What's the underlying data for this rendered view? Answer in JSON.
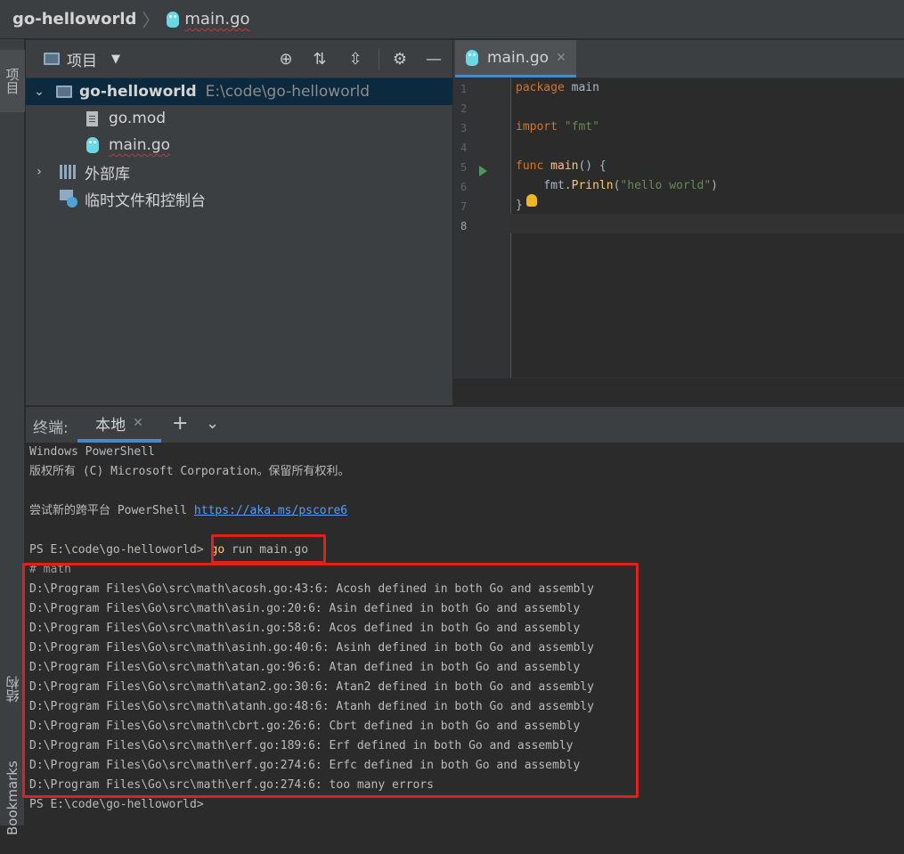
{
  "title_bar": {
    "project": "go-helloworld",
    "separator": "〉",
    "file": "main.go"
  },
  "left_strip": {
    "project_tab": "项目",
    "structure_tab": "结构",
    "bookmarks_tab": "Bookmarks"
  },
  "project_panel": {
    "title": "项目",
    "tree": [
      {
        "label": "go-helloworld",
        "path": "E:\\code\\go-helloworld"
      },
      {
        "label": "go.mod"
      },
      {
        "label": "main.go"
      },
      {
        "label": "外部库"
      },
      {
        "label": "临时文件和控制台"
      }
    ]
  },
  "editor": {
    "tab_label": "main.go",
    "line_numbers": [
      "1",
      "2",
      "3",
      "4",
      "5",
      "6",
      "7",
      "8"
    ],
    "lines": {
      "l1_kw": "package",
      "l1_rest": " main",
      "l3_kw": "import",
      "l3_str": "\"fmt\"",
      "l5_kw": "func",
      "l5_fn": "main",
      "l5_rest": "() {",
      "l6_pkg": "    fmt.",
      "l6_mth": "Prinln",
      "l6_open": "(",
      "l6_str": "\"hello world\"",
      "l6_close": ")",
      "l7": "}"
    }
  },
  "terminal": {
    "label": "终端:",
    "tab": "本地",
    "lines": [
      "Windows PowerShell",
      "版权所有 (C) Microsoft Corporation。保留所有权利。",
      "",
      "",
      "",
      "PS E:\\code\\go-helloworld> ",
      "# math",
      "D:\\Program Files\\Go\\src\\math\\acosh.go:43:6: Acosh defined in both Go and assembly",
      "D:\\Program Files\\Go\\src\\math\\asin.go:20:6: Asin defined in both Go and assembly",
      "D:\\Program Files\\Go\\src\\math\\asin.go:58:6: Acos defined in both Go and assembly",
      "D:\\Program Files\\Go\\src\\math\\asinh.go:40:6: Asinh defined in both Go and assembly",
      "D:\\Program Files\\Go\\src\\math\\atan.go:96:6: Atan defined in both Go and assembly",
      "D:\\Program Files\\Go\\src\\math\\atan2.go:30:6: Atan2 defined in both Go and assembly",
      "D:\\Program Files\\Go\\src\\math\\atanh.go:48:6: Atanh defined in both Go and assembly",
      "D:\\Program Files\\Go\\src\\math\\cbrt.go:26:6: Cbrt defined in both Go and assembly",
      "D:\\Program Files\\Go\\src\\math\\erf.go:189:6: Erf defined in both Go and assembly",
      "D:\\Program Files\\Go\\src\\math\\erf.go:274:6: Erfc defined in both Go and assembly",
      "D:\\Program Files\\Go\\src\\math\\erf.go:274:6: too many errors",
      "PS E:\\code\\go-helloworld>"
    ],
    "pscore_prefix": "尝试新的跨平台 PowerShell ",
    "pscore_link": "https://aka.ms/pscore6",
    "cmd_go": "go",
    "cmd_rest": " run main.go"
  },
  "colors": {
    "annotation_box": "#e0201b",
    "accent": "#4a88c7"
  }
}
